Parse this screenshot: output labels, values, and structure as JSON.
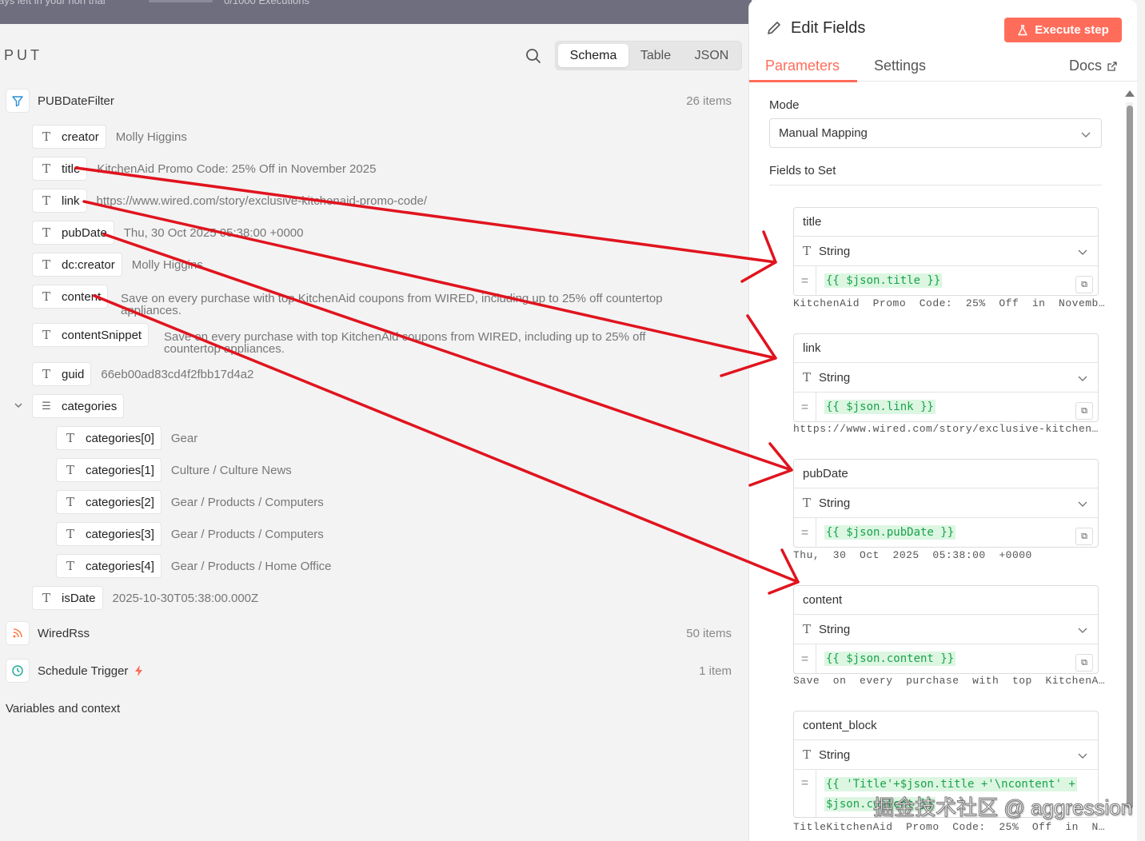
{
  "top_notice": {
    "text": "ays left in your non trial",
    "executions": "0/1000 Executions"
  },
  "input_panel": {
    "header": "PUT",
    "view_tabs": [
      {
        "label": "Schema"
      },
      {
        "label": "Table"
      },
      {
        "label": "JSON"
      }
    ],
    "nodes": [
      {
        "name": "PUBDateFilter",
        "count": "26 items"
      },
      {
        "name": "WiredRss",
        "count": "50 items"
      },
      {
        "name": "Schedule Trigger",
        "count": "1 item"
      }
    ],
    "fields": [
      {
        "key": "creator",
        "value": "Molly Higgins"
      },
      {
        "key": "title",
        "value": "KitchenAid Promo Code: 25% Off in November 2025"
      },
      {
        "key": "link",
        "value": "https://www.wired.com/story/exclusive-kitchenaid-promo-code/"
      },
      {
        "key": "pubDate",
        "value": "Thu, 30 Oct 2025 05:38:00 +0000"
      },
      {
        "key": "dc:creator",
        "value": "Molly Higgins"
      },
      {
        "key": "content",
        "value_line1": "Save on every purchase with top KitchenAid coupons from WIRED, including up to 25% off countertop",
        "value_line2": "appliances."
      },
      {
        "key": "contentSnippet",
        "value_line1": "Save on every purchase with top KitchenAid coupons from WIRED, including up to 25% off",
        "value_line2": "countertop appliances."
      },
      {
        "key": "guid",
        "value": "66eb00ad83cd4f2fbb17d4a2"
      },
      {
        "key": "categories",
        "value": ""
      },
      {
        "key": "categories[0]",
        "value": "Gear"
      },
      {
        "key": "categories[1]",
        "value": "Culture / Culture News"
      },
      {
        "key": "categories[2]",
        "value": "Gear / Products / Computers"
      },
      {
        "key": "categories[3]",
        "value": "Gear / Products / Computers"
      },
      {
        "key": "categories[4]",
        "value": "Gear / Products / Home Office"
      },
      {
        "key": "isDate",
        "value": "2025-10-30T05:38:00.000Z"
      }
    ],
    "variables_label": "Variables and context"
  },
  "edit_panel": {
    "title": "Edit Fields",
    "execute_label": "Execute step",
    "tabs": [
      {
        "label": "Parameters"
      },
      {
        "label": "Settings"
      }
    ],
    "docs_label": "Docs",
    "mode_label": "Mode",
    "mode_value": "Manual Mapping",
    "fields_to_set_label": "Fields to Set",
    "assignments": [
      {
        "name": "title",
        "type": "String",
        "expression": "{{ $json.title }}",
        "preview": "KitchenAid  Promo  Code:  25%  Off  in  Novemb…"
      },
      {
        "name": "link",
        "type": "String",
        "expression": "{{ $json.link }}",
        "preview": "https://www.wired.com/story/exclusive-kitchen…"
      },
      {
        "name": "pubDate",
        "type": "String",
        "expression": "{{ $json.pubDate }}",
        "preview": "Thu,  30  Oct  2025  05:38:00  +0000"
      },
      {
        "name": "content",
        "type": "String",
        "expression": "{{ $json.content }}",
        "preview": "Save  on  every  purchase  with  top  KitchenA…"
      },
      {
        "name": "content_block",
        "type": "String",
        "expression_line1": "{{ 'Title'+$json.title +'\\ncontent' +",
        "expression_line2": "$json.content }}",
        "preview": "TitleKitchenAid  Promo  Code:  25%  Off  in  N…"
      }
    ]
  },
  "watermark": "掘金技术社区 @ aggression",
  "colors": {
    "accent": "#ff6d5a",
    "arrow": "#e0141e",
    "expression_text": "#1aa34a",
    "expression_bg": "#dcf6e2"
  }
}
